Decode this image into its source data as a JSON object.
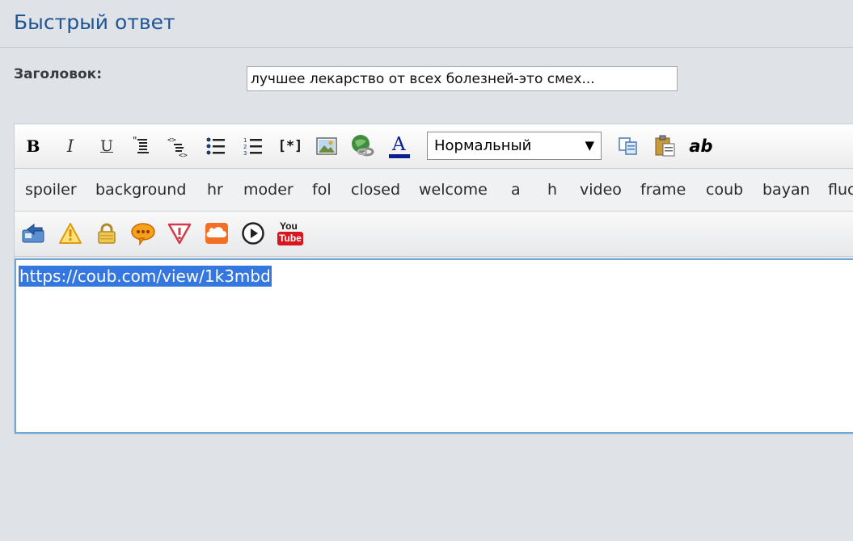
{
  "header": {
    "title": "Быстрый ответ"
  },
  "subject": {
    "label": "Заголовок:",
    "value": "лучшее лекарство от всех болезней-это смех..."
  },
  "toolbar": {
    "row1_buttons": [
      {
        "name": "bold",
        "label": "B"
      },
      {
        "name": "italic",
        "label": "I"
      },
      {
        "name": "underline",
        "label": "U"
      },
      {
        "name": "quote-icon"
      },
      {
        "name": "code-icon"
      },
      {
        "name": "bullet-list-icon"
      },
      {
        "name": "numbered-list-icon"
      },
      {
        "name": "list-item",
        "label": "[*]"
      },
      {
        "name": "image-icon"
      },
      {
        "name": "link-icon"
      },
      {
        "name": "font-color",
        "label": "A"
      }
    ],
    "format_select": {
      "value": "Нормальный",
      "arrow": "▼"
    },
    "row1_right_buttons": [
      {
        "name": "copy-icon"
      },
      {
        "name": "paste-icon"
      },
      {
        "name": "spellcheck",
        "label": "ab"
      }
    ],
    "tags": [
      "spoiler",
      "background",
      "hr",
      "moder",
      "fol",
      "closed",
      "welcome",
      "a",
      "h",
      "video",
      "frame",
      "coub",
      "bayan",
      "fluc"
    ],
    "row3_buttons": [
      {
        "name": "transfer-icon"
      },
      {
        "name": "warning-icon"
      },
      {
        "name": "lock-icon"
      },
      {
        "name": "speech-bubble-icon"
      },
      {
        "name": "exclamation-triangle-icon"
      },
      {
        "name": "soundcloud-icon"
      },
      {
        "name": "play-icon"
      },
      {
        "name": "youtube-icon",
        "label_top": "You",
        "label_bottom": "Tube"
      }
    ]
  },
  "textarea": {
    "content": "https://coub.com/view/1k3mbd"
  },
  "colors": {
    "title": "#1f5594",
    "selection": "#3477e0",
    "focus_border": "#6da6d8"
  }
}
